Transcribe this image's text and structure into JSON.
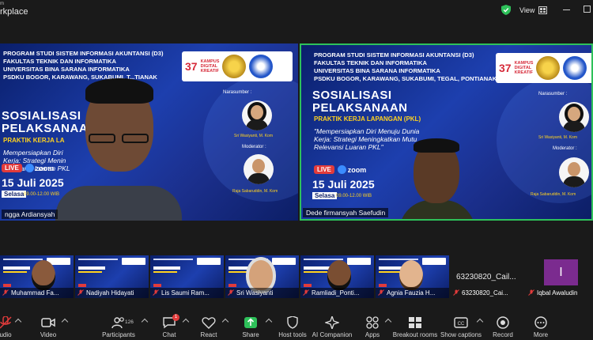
{
  "window": {
    "title_sup": "m",
    "title": "rkplace",
    "view_label": "View"
  },
  "tiles": [
    {
      "participant": "ngga Ardiansyah",
      "slide": {
        "header_lines": [
          "PROGRAM STUDI SISTEM INFORMASI AKUNTANSI (D3)",
          "FAKULTAS TEKNIK DAN INFORMATIKA",
          "UNIVERSITAS BINA SARANA INFORMATIKA",
          "PSDKU BOGOR, KARAWANG, SUKABUMI, T...TIANAK"
        ],
        "title_lines": [
          "SOSIALISASI",
          "PELAKSANAAN"
        ],
        "subtitle": "PRAKTIK KERJA LA",
        "quote_lines": [
          "Mempersiapkan Diri",
          "Kerja: Strategi Menin",
          "Relevansi Luaran PKL"
        ],
        "date": "15 Juli 2025",
        "day": "Selasa",
        "time": "09.00-12.00 WIB",
        "narasumber_label": "Narasumber :",
        "narasumber_name": "Sri Wasiyanti, M. Kom",
        "moderator_label": "Moderator :",
        "moderator_name": "Raja Sabaruddin, M. Kom"
      }
    },
    {
      "participant": "Dede firmansyah Saefudin",
      "slide": {
        "header_lines": [
          "PROGRAM STUDI SISTEM INFORMASI AKUNTANSI (D3)",
          "FAKULTAS TEKNIK DAN INFORMATIKA",
          "UNIVERSITAS BINA SARANA INFORMATIKA",
          "PSDKU BOGOR, KARAWANG, SUKABUMI, TEGAL, PONTIANAK"
        ],
        "title_lines": [
          "SOSIALISASI",
          "PELAKSANAAN"
        ],
        "subtitle": "PRAKTIK KERJA LAPANGAN (PKL)",
        "quote_lines": [
          "\"Mempersiapkan Diri Menuju Dunia",
          "Kerja: Strategi Meningkatkan Mutu",
          "Relevansi Luaran PKL\""
        ],
        "date": "15 Juli 2025",
        "day": "Selasa",
        "time": "09.00-12.00 WIB",
        "narasumber_label": "Narasumber :",
        "narasumber_name": "Sri Wasiyanti, M. Kom",
        "moderator_label": "Moderator :",
        "moderator_name": "Raja Sabaruddin, M. Kom"
      }
    }
  ],
  "logo_text": {
    "number": "37",
    "kdk": [
      "KAMPUS",
      "DIGITAL",
      "KREATIF"
    ],
    "univ": "UNIVERSITAS"
  },
  "live_label": "LIVE",
  "zoom_label": "zoom",
  "gallery": [
    {
      "name": "Muhammad Fa...",
      "kind": "slide-face",
      "skin": "#8a5a3c"
    },
    {
      "name": "Nadiyah Hidayati",
      "kind": "slide"
    },
    {
      "name": "Lis Saumi Ram...",
      "kind": "slide"
    },
    {
      "name": "Sri Wasiyanti",
      "kind": "slide-face",
      "skin": "#d4a27a"
    },
    {
      "name": "Ramliadi_Ponti...",
      "kind": "slide-face",
      "skin": "#7a4e32"
    },
    {
      "name": "Agnia Fauzia H...",
      "kind": "slide-face",
      "skin": "#e2b48e"
    },
    {
      "name": "63230820_Cai...",
      "kind": "dark",
      "big": "63230820_Cail..."
    },
    {
      "name": "Iqbal Awaludin",
      "kind": "avatar",
      "initial": "I"
    }
  ],
  "toolbar": [
    {
      "label": "udio",
      "icon": "mic-off-icon"
    },
    {
      "label": "Video",
      "icon": "video-icon"
    },
    {
      "label": "Participants",
      "icon": "participants-icon",
      "count": "126"
    },
    {
      "label": "Chat",
      "icon": "chat-icon",
      "badge": "1"
    },
    {
      "label": "React",
      "icon": "heart-icon"
    },
    {
      "label": "Share",
      "icon": "share-icon"
    },
    {
      "label": "Host tools",
      "icon": "shield-icon"
    },
    {
      "label": "AI Companion",
      "icon": "sparkle-icon"
    },
    {
      "label": "Apps",
      "icon": "apps-icon"
    },
    {
      "label": "Breakout rooms",
      "icon": "breakout-icon"
    },
    {
      "label": "Show captions",
      "icon": "captions-icon"
    },
    {
      "label": "Record",
      "icon": "record-icon"
    },
    {
      "label": "More",
      "icon": "more-icon"
    }
  ],
  "colors": {
    "speaking_border": "#2ec15a",
    "slide_blue": "#1d3fae",
    "accent_yellow": "#ffd21f",
    "live_red": "#e23b3b"
  }
}
